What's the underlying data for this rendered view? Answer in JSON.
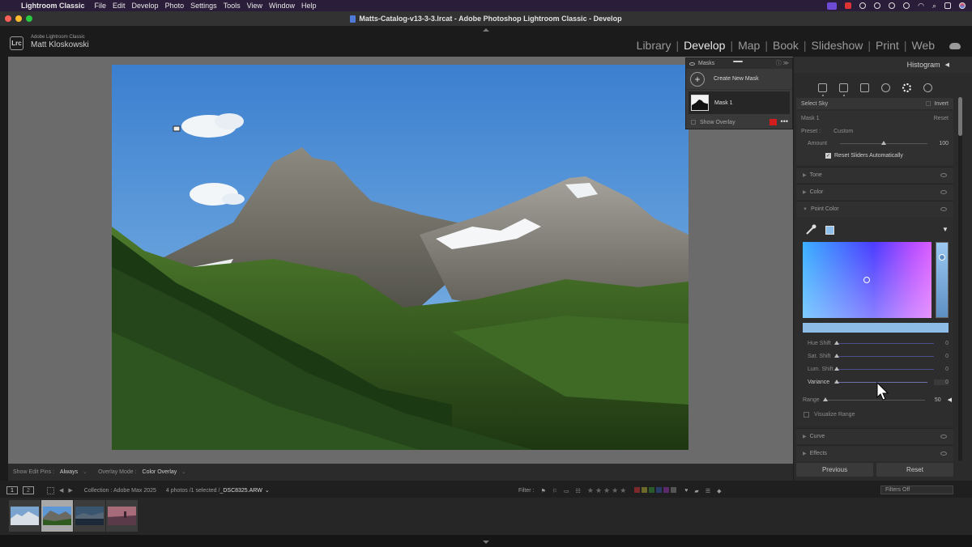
{
  "menubar": {
    "app": "Lightroom Classic",
    "items": [
      "File",
      "Edit",
      "Develop",
      "Photo",
      "Settings",
      "Tools",
      "View",
      "Window",
      "Help"
    ]
  },
  "window": {
    "title": "Matts-Catalog-v13-3-3.lrcat - Adobe Photoshop Lightroom Classic - Develop"
  },
  "identity": {
    "app_name": "Adobe Lightroom Classic",
    "user": "Matt Kloskowski",
    "badge": "Lrc"
  },
  "modules": [
    "Library",
    "Develop",
    "Map",
    "Book",
    "Slideshow",
    "Print",
    "Web"
  ],
  "active_module": "Develop",
  "masks_panel": {
    "title": "Masks",
    "create_label": "Create New Mask",
    "mask_name": "Mask 1",
    "show_overlay": "Show Overlay",
    "overlay_color": "#d31c1c"
  },
  "toolbar": {
    "show_edit_pins_label": "Show Edit Pins :",
    "show_edit_pins_value": "Always",
    "overlay_mode_label": "Overlay Mode :",
    "overlay_mode_value": "Color Overlay"
  },
  "right_panel": {
    "histogram": "Histogram",
    "select_label": "Select Sky",
    "invert": "Invert",
    "mask_label": "Mask 1",
    "reset": "Reset",
    "preset_label": "Preset :",
    "preset_value": "Custom",
    "amount_label": "Amount",
    "amount_value": "100",
    "amount_fraction": 1.0,
    "reset_sliders": "Reset Sliders Automatically",
    "sections": {
      "tone": "Tone",
      "color": "Color",
      "point_color": "Point Color",
      "curve": "Curve",
      "effects": "Effects"
    },
    "point_color": {
      "swatch_color": "#8fc0eb",
      "sliders": [
        {
          "label": "Hue Shift",
          "value": "0"
        },
        {
          "label": "Sat. Shift",
          "value": "0"
        },
        {
          "label": "Lum. Shift",
          "value": "0"
        },
        {
          "label": "Variance",
          "value": "0"
        }
      ],
      "range_label": "Range",
      "range_value": "50",
      "visualize_range": "Visualize Range"
    },
    "previous": "Previous",
    "reset_button": "Reset"
  },
  "filmstrip": {
    "view1": "1",
    "view2": "2",
    "collection": "Collection : Adobe Max 2025",
    "count": "4 photos /1 selected /",
    "filename": "_DSC8325.ARW",
    "filter_label": "Filter :",
    "filters_off": "Filters Off",
    "thumbnails": [
      {
        "name": "thumb-1",
        "selected": false
      },
      {
        "name": "thumb-2",
        "selected": true
      },
      {
        "name": "thumb-3",
        "selected": false
      },
      {
        "name": "thumb-4",
        "selected": false
      }
    ]
  }
}
